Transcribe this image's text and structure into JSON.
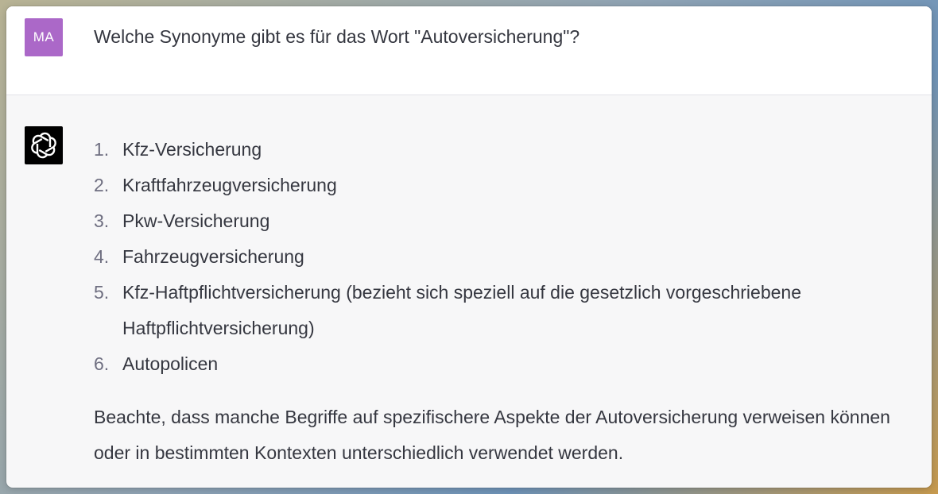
{
  "conversation": {
    "user": {
      "initials": "MA",
      "message": "Welche Synonyme gibt es für das Wort \"Autoversicherung\"?",
      "avatar_color": "#ab68c8"
    },
    "assistant": {
      "avatar_icon": "openai-logo-icon",
      "list_items": [
        {
          "num": "1.",
          "text": "Kfz-Versicherung"
        },
        {
          "num": "2.",
          "text": "Kraftfahrzeugversicherung"
        },
        {
          "num": "3.",
          "text": "Pkw-Versicherung"
        },
        {
          "num": "4.",
          "text": "Fahrzeugversicherung"
        },
        {
          "num": "5.",
          "text": "Kfz-Haftpflichtversicherung (bezieht sich speziell auf die gesetzlich vorgeschriebene Haftpflichtversicherung)"
        },
        {
          "num": "6.",
          "text": "Autopolicen"
        }
      ],
      "closing_note": "Beachte, dass manche Begriffe auf spezifischere Aspekte der Autoversicherung verweisen können oder in bestimmten Kontexten unterschiedlich verwendet werden."
    }
  }
}
